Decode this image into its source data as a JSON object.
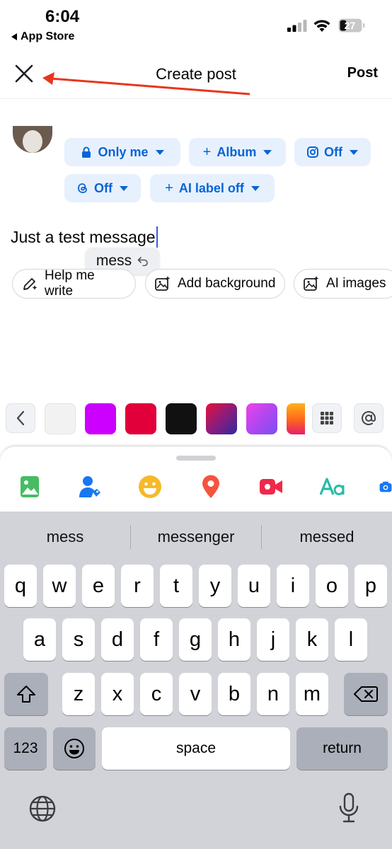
{
  "status_bar": {
    "time": "6:04",
    "back_app": "App Store",
    "battery": "27"
  },
  "header": {
    "title": "Create post",
    "post_label": "Post"
  },
  "audience": {
    "chips": [
      {
        "label": "Only me",
        "icon": "lock-icon"
      },
      {
        "label": "Album",
        "icon": "plus-icon"
      },
      {
        "label": "Off",
        "icon": "instagram-icon"
      },
      {
        "label": "Off",
        "icon": "threads-icon"
      },
      {
        "label": "AI label off",
        "icon": "plus-icon"
      }
    ]
  },
  "composer": {
    "text": "Just a test message",
    "autocorrect_suggestion": "mess"
  },
  "ai_tools": [
    {
      "label": "Help me write",
      "icon": "pencil-sparkle-icon"
    },
    {
      "label": "Add background",
      "icon": "image-sparkle-icon"
    },
    {
      "label": "AI images",
      "icon": "image-sparkle-icon"
    }
  ],
  "backgrounds": {
    "colors": [
      "#f2f2f2",
      "#cc00ff",
      "#e2003a",
      "#111111",
      "gradient-red-blue",
      "gradient-pink-violet",
      "gradient-orange"
    ]
  },
  "composer_tools": [
    "photo-icon",
    "tag-people-icon",
    "emoji-icon",
    "location-pin-icon",
    "video-camera-icon",
    "text-style-icon",
    "camera-icon"
  ],
  "keyboard": {
    "predictions": [
      "mess",
      "messenger",
      "messed"
    ],
    "row1": [
      "q",
      "w",
      "e",
      "r",
      "t",
      "y",
      "u",
      "i",
      "o",
      "p"
    ],
    "row2": [
      "a",
      "s",
      "d",
      "f",
      "g",
      "h",
      "j",
      "k",
      "l"
    ],
    "row3": [
      "z",
      "x",
      "c",
      "v",
      "b",
      "n",
      "m"
    ],
    "numbers_label": "123",
    "space_label": "space",
    "return_label": "return"
  },
  "colors": {
    "accent": "#0864d6",
    "chip_bg": "#e7f1fd",
    "annotation": "#e8361e"
  }
}
